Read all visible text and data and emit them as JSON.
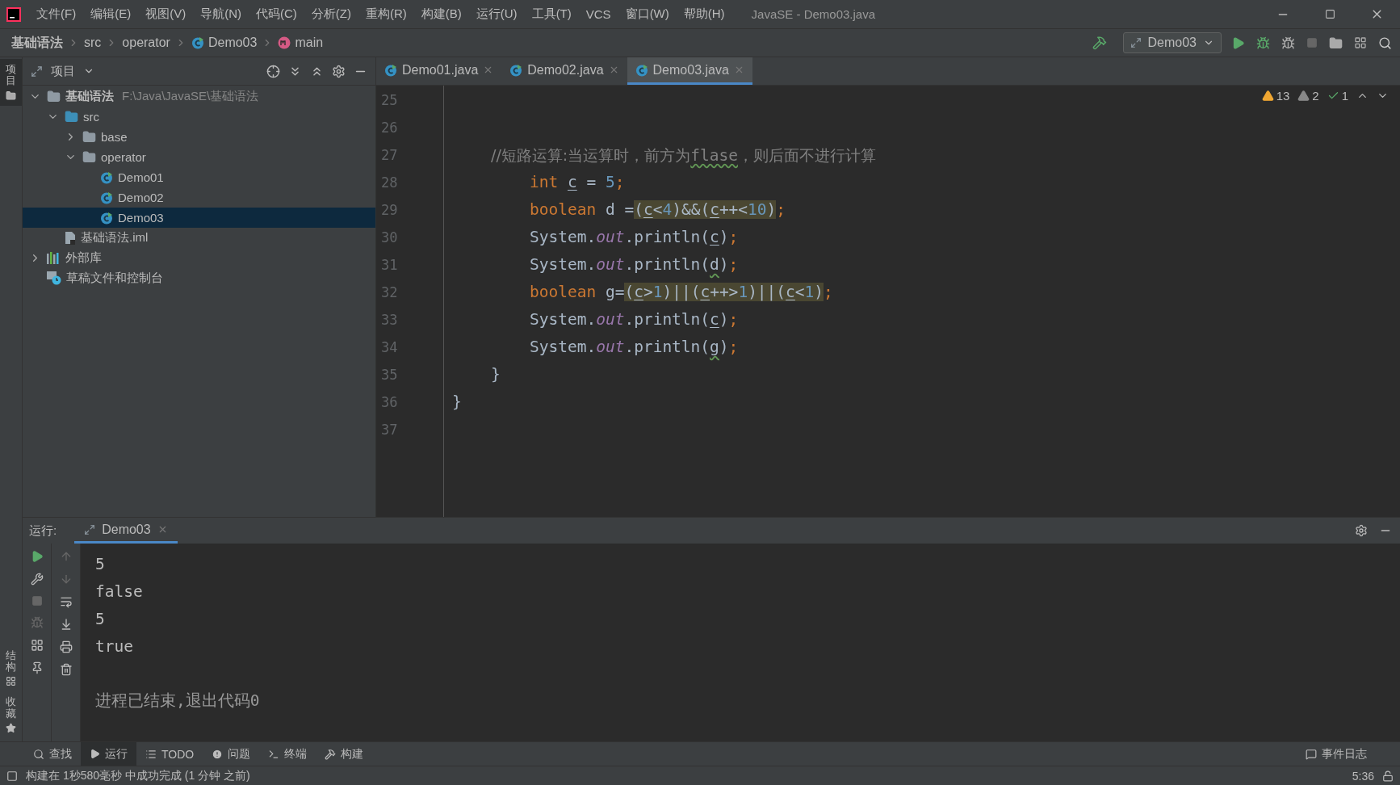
{
  "window": {
    "title": "JavaSE - Demo03.java"
  },
  "menu": [
    "文件(F)",
    "编辑(E)",
    "视图(V)",
    "导航(N)",
    "代码(C)",
    "分析(Z)",
    "重构(R)",
    "构建(B)",
    "运行(U)",
    "工具(T)",
    "VCS",
    "窗口(W)",
    "帮助(H)"
  ],
  "breadcrumbs": [
    {
      "label": "基础语法",
      "kind": "project"
    },
    {
      "label": "src",
      "kind": "folder"
    },
    {
      "label": "operator",
      "kind": "folder"
    },
    {
      "label": "Demo03",
      "kind": "class"
    },
    {
      "label": "main",
      "kind": "method"
    }
  ],
  "run_config": {
    "label": "Demo03"
  },
  "side_strip": {
    "top": [
      {
        "label": "项目",
        "selected": true
      }
    ],
    "bottom": [
      {
        "label": "结构",
        "selected": false
      },
      {
        "label": "收藏",
        "selected": false
      }
    ]
  },
  "project_panel": {
    "title": "项目",
    "tree": [
      {
        "label": "基础语法",
        "path": "F:\\Java\\JavaSE\\基础语法",
        "kind": "module",
        "expanded": true,
        "selected": false,
        "children": [
          {
            "label": "src",
            "kind": "source",
            "expanded": true,
            "selected": false,
            "children": [
              {
                "label": "base",
                "kind": "package",
                "expanded": false,
                "selected": false
              },
              {
                "label": "operator",
                "kind": "package",
                "expanded": true,
                "selected": false,
                "children": [
                  {
                    "label": "Demo01",
                    "kind": "class",
                    "selected": false
                  },
                  {
                    "label": "Demo02",
                    "kind": "class",
                    "selected": false
                  },
                  {
                    "label": "Demo03",
                    "kind": "class",
                    "selected": true
                  }
                ]
              }
            ]
          },
          {
            "label": "基础语法.iml",
            "kind": "iml",
            "selected": false
          }
        ]
      },
      {
        "label": "外部库",
        "kind": "library",
        "expanded": false,
        "selected": false
      },
      {
        "label": "草稿文件和控制台",
        "kind": "scratch",
        "selected": false
      }
    ]
  },
  "editor": {
    "tabs": [
      {
        "label": "Demo01.java",
        "selected": false
      },
      {
        "label": "Demo02.java",
        "selected": false
      },
      {
        "label": "Demo03.java",
        "selected": true
      }
    ],
    "inspections": {
      "warnings": "13",
      "weak_warnings": "2",
      "ok": "1"
    },
    "lines": [
      {
        "no": "25",
        "kind": "blank"
      },
      {
        "no": "26",
        "kind": "blank"
      },
      {
        "no": "27",
        "kind": "member",
        "tokens": [
          {
            "text": "//短路运算:当运算时，前方为",
            "kind": "comment",
            "highlighted": false
          },
          {
            "text": "flase",
            "kind": "typo",
            "highlighted": false
          },
          {
            "text": "，则后面不进行计算",
            "kind": "comment",
            "highlighted": false
          }
        ]
      },
      {
        "no": "28",
        "kind": "statement",
        "tokens": [
          {
            "text": "int ",
            "kind": "keyword",
            "highlighted": false
          },
          {
            "text": "c",
            "kind": "var",
            "highlighted": false
          },
          {
            "text": " = ",
            "kind": "plain",
            "highlighted": false
          },
          {
            "text": "5",
            "kind": "number",
            "highlighted": false
          },
          {
            "text": ";",
            "kind": "keyword",
            "highlighted": false
          }
        ]
      },
      {
        "no": "29",
        "kind": "statement",
        "tokens": [
          {
            "text": "boolean",
            "kind": "keyword",
            "highlighted": false
          },
          {
            "text": " d =",
            "kind": "plain",
            "highlighted": false
          },
          {
            "text": "(",
            "kind": "plain",
            "highlighted": true
          },
          {
            "text": "c",
            "kind": "var",
            "highlighted": true
          },
          {
            "text": "<",
            "kind": "plain",
            "highlighted": true
          },
          {
            "text": "4",
            "kind": "number",
            "highlighted": true
          },
          {
            "text": ")&&(",
            "kind": "plain",
            "highlighted": true
          },
          {
            "text": "c",
            "kind": "var",
            "highlighted": true
          },
          {
            "text": "++<",
            "kind": "plain",
            "highlighted": true
          },
          {
            "text": "10",
            "kind": "number",
            "highlighted": true
          },
          {
            "text": ")",
            "kind": "plain",
            "highlighted": true
          },
          {
            "text": ";",
            "kind": "keyword",
            "highlighted": false
          }
        ]
      },
      {
        "no": "30",
        "kind": "statement",
        "tokens": [
          {
            "text": "System.",
            "kind": "plain",
            "highlighted": false
          },
          {
            "text": "out",
            "kind": "field",
            "highlighted": false
          },
          {
            "text": ".println(",
            "kind": "plain",
            "highlighted": false
          },
          {
            "text": "c",
            "kind": "var",
            "highlighted": false
          },
          {
            "text": ")",
            "kind": "plain",
            "highlighted": false
          },
          {
            "text": ";",
            "kind": "keyword",
            "highlighted": false
          }
        ]
      },
      {
        "no": "31",
        "kind": "statement",
        "tokens": [
          {
            "text": "System.",
            "kind": "plain",
            "highlighted": false
          },
          {
            "text": "out",
            "kind": "field",
            "highlighted": false
          },
          {
            "text": ".println(",
            "kind": "plain",
            "highlighted": false
          },
          {
            "text": "d",
            "kind": "typo",
            "highlighted": false
          },
          {
            "text": ")",
            "kind": "plain",
            "highlighted": false
          },
          {
            "text": ";",
            "kind": "keyword",
            "highlighted": false
          }
        ]
      },
      {
        "no": "32",
        "kind": "statement",
        "tokens": [
          {
            "text": "boolean",
            "kind": "keyword",
            "highlighted": false
          },
          {
            "text": " g=",
            "kind": "plain",
            "highlighted": false
          },
          {
            "text": "(",
            "kind": "plain",
            "highlighted": true
          },
          {
            "text": "c",
            "kind": "var",
            "highlighted": true
          },
          {
            "text": ">",
            "kind": "plain",
            "highlighted": true
          },
          {
            "text": "1",
            "kind": "number",
            "highlighted": true
          },
          {
            "text": ")||(",
            "kind": "plain",
            "highlighted": true
          },
          {
            "text": "c",
            "kind": "var",
            "highlighted": true
          },
          {
            "text": "++>",
            "kind": "plain",
            "highlighted": true
          },
          {
            "text": "1",
            "kind": "number",
            "highlighted": true
          },
          {
            "text": ")||(",
            "kind": "plain",
            "highlighted": true
          },
          {
            "text": "c",
            "kind": "var",
            "highlighted": true
          },
          {
            "text": "<",
            "kind": "plain",
            "highlighted": true
          },
          {
            "text": "1",
            "kind": "number",
            "highlighted": true
          },
          {
            "text": ")",
            "kind": "plain",
            "highlighted": true
          },
          {
            "text": ";",
            "kind": "keyword",
            "highlighted": false
          }
        ]
      },
      {
        "no": "33",
        "kind": "statement",
        "tokens": [
          {
            "text": "System.",
            "kind": "plain",
            "highlighted": false
          },
          {
            "text": "out",
            "kind": "field",
            "highlighted": false
          },
          {
            "text": ".println(",
            "kind": "plain",
            "highlighted": false
          },
          {
            "text": "c",
            "kind": "var",
            "highlighted": false
          },
          {
            "text": ")",
            "kind": "plain",
            "highlighted": false
          },
          {
            "text": ";",
            "kind": "keyword",
            "highlighted": false
          }
        ]
      },
      {
        "no": "34",
        "kind": "statement",
        "tokens": [
          {
            "text": "System.",
            "kind": "plain",
            "highlighted": false
          },
          {
            "text": "out",
            "kind": "field",
            "highlighted": false
          },
          {
            "text": ".println(",
            "kind": "plain",
            "highlighted": false
          },
          {
            "text": "g",
            "kind": "typo",
            "highlighted": false
          },
          {
            "text": ")",
            "kind": "plain",
            "highlighted": false
          },
          {
            "text": ";",
            "kind": "keyword",
            "highlighted": false
          }
        ]
      },
      {
        "no": "35",
        "kind": "member",
        "tokens": [
          {
            "text": "}",
            "kind": "plain",
            "highlighted": false
          }
        ]
      },
      {
        "no": "36",
        "kind": "top",
        "tokens": [
          {
            "text": "}",
            "kind": "plain",
            "highlighted": false
          }
        ]
      },
      {
        "no": "37",
        "kind": "blank"
      }
    ]
  },
  "run_panel": {
    "label": "运行:",
    "tabs": [
      {
        "label": "Demo03",
        "selected": true
      }
    ],
    "output": [
      {
        "text": "5",
        "kind": "stdout"
      },
      {
        "text": "false",
        "kind": "stdout"
      },
      {
        "text": "5",
        "kind": "stdout"
      },
      {
        "text": "true",
        "kind": "stdout"
      },
      {
        "text": "进程已结束,退出代码0",
        "kind": "exit"
      }
    ]
  },
  "tool_windows": [
    {
      "label": "查找",
      "kind": "search",
      "selected": false
    },
    {
      "label": "运行",
      "kind": "run",
      "selected": true
    },
    {
      "label": "TODO",
      "kind": "todo",
      "selected": false
    },
    {
      "label": "问题",
      "kind": "problems",
      "selected": false
    },
    {
      "label": "终端",
      "kind": "terminal",
      "selected": false
    },
    {
      "label": "构建",
      "kind": "build",
      "selected": false
    }
  ],
  "event_log": {
    "label": "事件日志"
  },
  "status_bar": {
    "message": "构建在 1秒580毫秒 中成功完成 (1 分钟 之前)",
    "position": "5:36"
  }
}
